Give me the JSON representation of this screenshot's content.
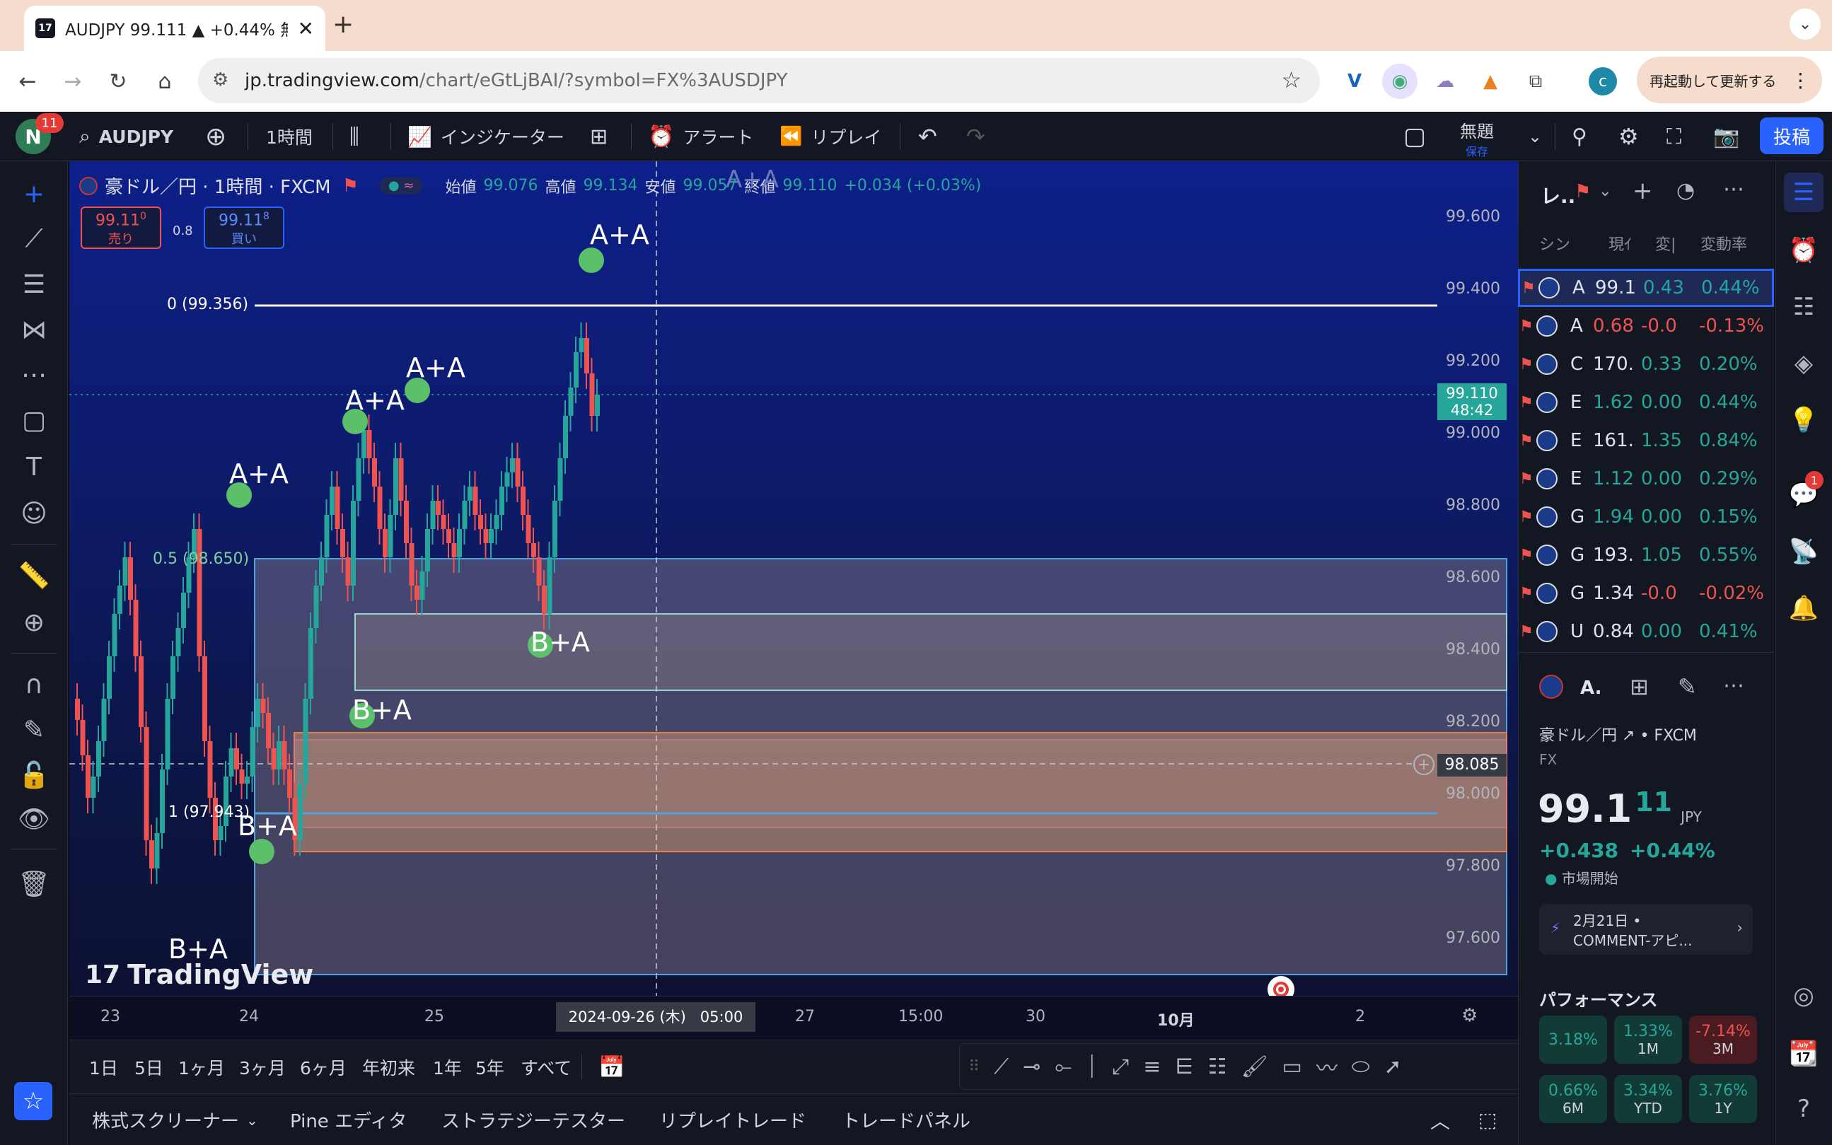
{
  "browser": {
    "tab_title": "AUDJPY 99.111 ▲ +0.44% 無",
    "favicon": "17",
    "url_host": "jp.tradingview.com",
    "url_path": "/chart/eGtLjBAI/?symbol=FX%3AUSDJPY",
    "relaunch": "再起動して更新する",
    "profile": "c"
  },
  "toolbar": {
    "avatar": "N",
    "badge": "11",
    "symbol": "AUDJPY",
    "interval": "1時間",
    "indicators": "インジケーター",
    "alert": "アラート",
    "replay": "リプレイ",
    "layout_title": "無題",
    "layout_saved": "保存",
    "publish": "投稿"
  },
  "legend": {
    "title": "豪ドル／円 · 1時間 · FXCM",
    "o_label": "始値",
    "o": "99.076",
    "h_label": "高値",
    "h": "99.134",
    "l_label": "安値",
    "l": "99.057",
    "c_label": "終値",
    "c": "99.110",
    "change": "+0.034 (+0.03%)",
    "sell_price": "99.11",
    "sell_sup": "0",
    "sell_label": "売り",
    "spread": "0.8",
    "buy_price": "99.11",
    "buy_sup": "8",
    "buy_label": "買い",
    "ghost": "A+A"
  },
  "price_axis": {
    "ticks": [
      "99.600",
      "99.400",
      "99.200",
      "99.000",
      "98.800",
      "98.600",
      "98.400",
      "98.200",
      "98.000",
      "97.800",
      "97.600"
    ],
    "current_price": "99.110",
    "countdown": "48:42",
    "crosshair_price": "98.085"
  },
  "fib": {
    "level0": "0 (99.356)",
    "level05": "0.5 (98.650)",
    "level1": "1 (97.943)"
  },
  "annotations": [
    "A+A",
    "A+A",
    "A+A",
    "A+A",
    "B+A",
    "B+A",
    "B+A",
    "B+A"
  ],
  "time_axis": {
    "labels": [
      "23",
      "24",
      "25",
      "27",
      "15:00",
      "30",
      "10月",
      "2"
    ],
    "crosshair": "2024-09-26 (木)   05:00"
  },
  "watermark": "TradingView",
  "timeframes": [
    "1日",
    "5日",
    "1ヶ月",
    "3ヶ月",
    "6ヶ月",
    "年初来",
    "1年",
    "5年",
    "すべて"
  ],
  "bottom_tabs": [
    "株式スクリーナー",
    "Pine エディタ",
    "ストラテジーテスター",
    "リプレイトレード",
    "トレードパネル"
  ],
  "watchlist": {
    "title": "レ..",
    "headers": [
      "シン",
      "現ｲ",
      "変|",
      "変動率"
    ],
    "rows": [
      {
        "sym": "A",
        "last": "99.1",
        "chg": "0.43",
        "pct": "0.44%",
        "up": true
      },
      {
        "sym": "A",
        "last": "0.68",
        "chg": "-0.0",
        "pct": "-0.13%",
        "up": false
      },
      {
        "sym": "C",
        "last": "170.",
        "chg": "0.33",
        "pct": "0.20%",
        "up": true
      },
      {
        "sym": "E",
        "last": "1.62",
        "chg": "0.00",
        "pct": "0.44%",
        "up": true
      },
      {
        "sym": "E",
        "last": "161.",
        "chg": "1.35",
        "pct": "0.84%",
        "up": true
      },
      {
        "sym": "E",
        "last": "1.12",
        "chg": "0.00",
        "pct": "0.29%",
        "up": true
      },
      {
        "sym": "G",
        "last": "1.94",
        "chg": "0.00",
        "pct": "0.15%",
        "up": true
      },
      {
        "sym": "G",
        "last": "193.",
        "chg": "1.05",
        "pct": "0.55%",
        "up": true
      },
      {
        "sym": "G",
        "last": "1.34",
        "chg": "-0.0",
        "pct": "-0.02%",
        "up": false
      },
      {
        "sym": "U",
        "last": "0.84",
        "chg": "0.00",
        "pct": "0.41%",
        "up": true
      }
    ]
  },
  "detail": {
    "symbol": "A.",
    "name": "豪ドル／円",
    "exchange": "• FXCM",
    "type": "FX",
    "price_main": "99.1",
    "price_small": "11",
    "currency": "JPY",
    "change": "+0.438",
    "change_pct": "+0.44%",
    "status": "市場開始",
    "news_date": "2月21日 •",
    "news_title": "COMMENT-アピ...",
    "perf_title": "パフォーマンス",
    "perf": [
      {
        "v": "3.18%",
        "p": "",
        "up": true
      },
      {
        "v": "1.33%",
        "p": "1M",
        "up": true
      },
      {
        "v": "-7.14%",
        "p": "3M",
        "up": false
      },
      {
        "v": "0.66%",
        "p": "6M",
        "up": true
      },
      {
        "v": "3.34%",
        "p": "YTD",
        "up": true
      },
      {
        "v": "3.76%",
        "p": "1Y",
        "up": true
      }
    ]
  },
  "notifications_badge": "1",
  "colors": {
    "up": "#26a69a",
    "down": "#ef5350",
    "accent": "#2962ff",
    "bg": "#131722"
  }
}
